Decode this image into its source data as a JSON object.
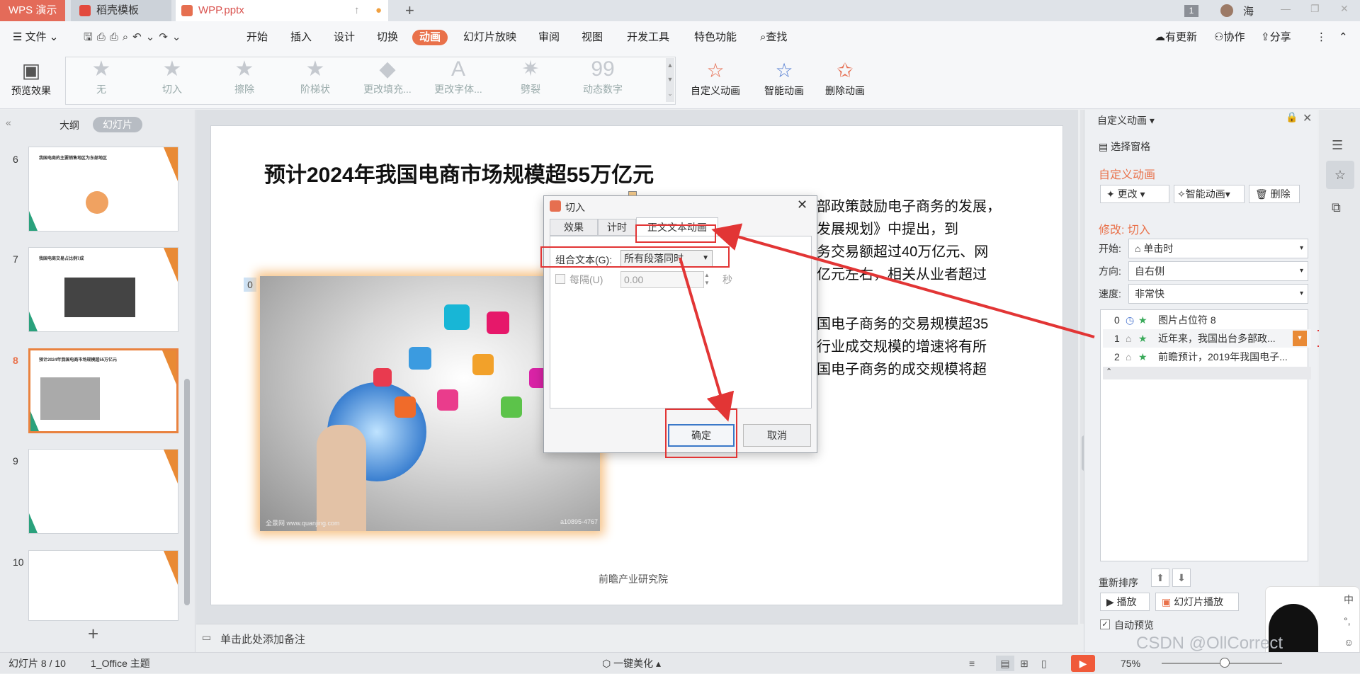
{
  "titlebar": {
    "wps_tab": "WPS 演示",
    "daoke_tab": "稻壳模板",
    "file_tab": "WPP.pptx",
    "page_badge": "1",
    "user": "海"
  },
  "menu": {
    "file": "文件",
    "items": [
      "开始",
      "插入",
      "设计",
      "切换",
      "动画",
      "幻灯片放映",
      "审阅",
      "视图",
      "开发工具",
      "特色功能"
    ],
    "search": "查找",
    "update": "有更新",
    "collab": "协作",
    "share": "分享"
  },
  "ribbon": {
    "preview": "预览效果",
    "effects": [
      "无",
      "切入",
      "擦除",
      "阶梯状",
      "更改填充...",
      "更改字体...",
      "劈裂",
      "动态数字"
    ],
    "custom_anim": "自定义动画",
    "smart_anim": "智能动画",
    "delete_anim": "删除动画"
  },
  "left": {
    "outline_tab": "大纲",
    "slides_tab": "幻灯片",
    "thumb_titles": {
      "6": "我国电商的主要销售地区为东部地区",
      "7": "我国电商交易占比例7成",
      "8": "预计2024年我国电商市场规模超55万亿元"
    },
    "numbers": [
      "6",
      "7",
      "8",
      "9",
      "10"
    ]
  },
  "slide": {
    "title": "预计2024年我国电商市场规模超55万亿元",
    "para1": [
      "部政策鼓励电子商务的发展，",
      "发展规划》中提出，到",
      "务交易额超过40万亿元、网",
      "亿元左右，相关从业者超过"
    ],
    "para2": [
      "国电子商务的交易规模超35",
      "行业成交规模的增速将有所",
      "国电子商务的成交规模将超"
    ],
    "footer": "前瞻产业研究院",
    "anim_tag": "0",
    "img_watermark1": "全景网 www.quanjing.com",
    "img_watermark2": "a10895-4767"
  },
  "dialog": {
    "title": "切入",
    "tabs": [
      "效果",
      "计时",
      "正文文本动画"
    ],
    "group_label": "组合文本(G):",
    "group_value": "所有段落同时",
    "every_label": "每隔(U)",
    "every_value": "0.00",
    "sec": "秒",
    "ok": "确定",
    "cancel": "取消"
  },
  "pane": {
    "header": "自定义动画",
    "selection_pane": "选择窗格",
    "section": "自定义动画",
    "change": "更改",
    "smart": "智能动画",
    "delete": "删除",
    "modify": "修改: 切入",
    "start_label": "开始:",
    "start_value": "单击时",
    "dir_label": "方向:",
    "dir_value": "自右侧",
    "speed_label": "速度:",
    "speed_value": "非常快",
    "list": [
      {
        "num": "0",
        "text": "图片占位符 8"
      },
      {
        "num": "1",
        "text": "近年来，我国出台多部政..."
      },
      {
        "num": "2",
        "text": "前瞻预计，2019年我国电子..."
      }
    ],
    "reorder": "重新排序",
    "play": "播放",
    "slideshow": "幻灯片播放",
    "autopreview": "自动预览"
  },
  "notes": {
    "placeholder": "单击此处添加备注"
  },
  "status": {
    "slide_count": "幻灯片 8 / 10",
    "theme": "1_Office 主题",
    "beautify": "一键美化",
    "zoom": "75%",
    "watermark": "CSDN @OllCorrect"
  },
  "colors": {
    "accent": "#e9714a",
    "red": "#e23535"
  }
}
